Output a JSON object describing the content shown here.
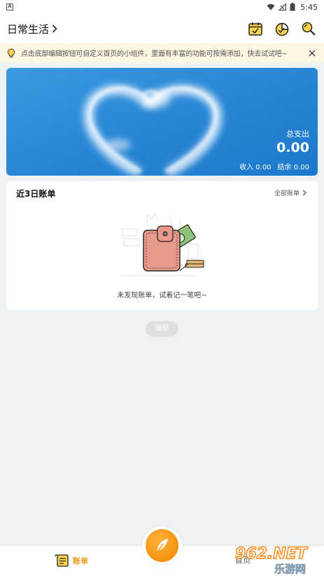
{
  "status_bar": {
    "time": "5:45"
  },
  "header": {
    "title": "日常生活"
  },
  "tip": {
    "text": "点击底部编辑按钮可自定义首页的小组件，里面有丰富的功能可按需添加，快去试试吧~"
  },
  "banner": {
    "total_label": "总支出",
    "total_value": "0.00",
    "income_label": "收入",
    "income_value": "0.00",
    "balance_label": "结余",
    "balance_value": "0.00"
  },
  "recent": {
    "title": "近3日账单",
    "all_link": "全部账单",
    "empty_text": "未发现账单，试着记一笔吧~"
  },
  "edit_button": {
    "label": "编辑"
  },
  "bottom_nav": {
    "bill_label": "账单",
    "home_label": "首页"
  },
  "watermark": {
    "brand": "962.NET",
    "sub": "乐游网"
  },
  "colors": {
    "accent": "#F5930F",
    "banner": "#2A88D6",
    "background": "#EFF2F5"
  }
}
